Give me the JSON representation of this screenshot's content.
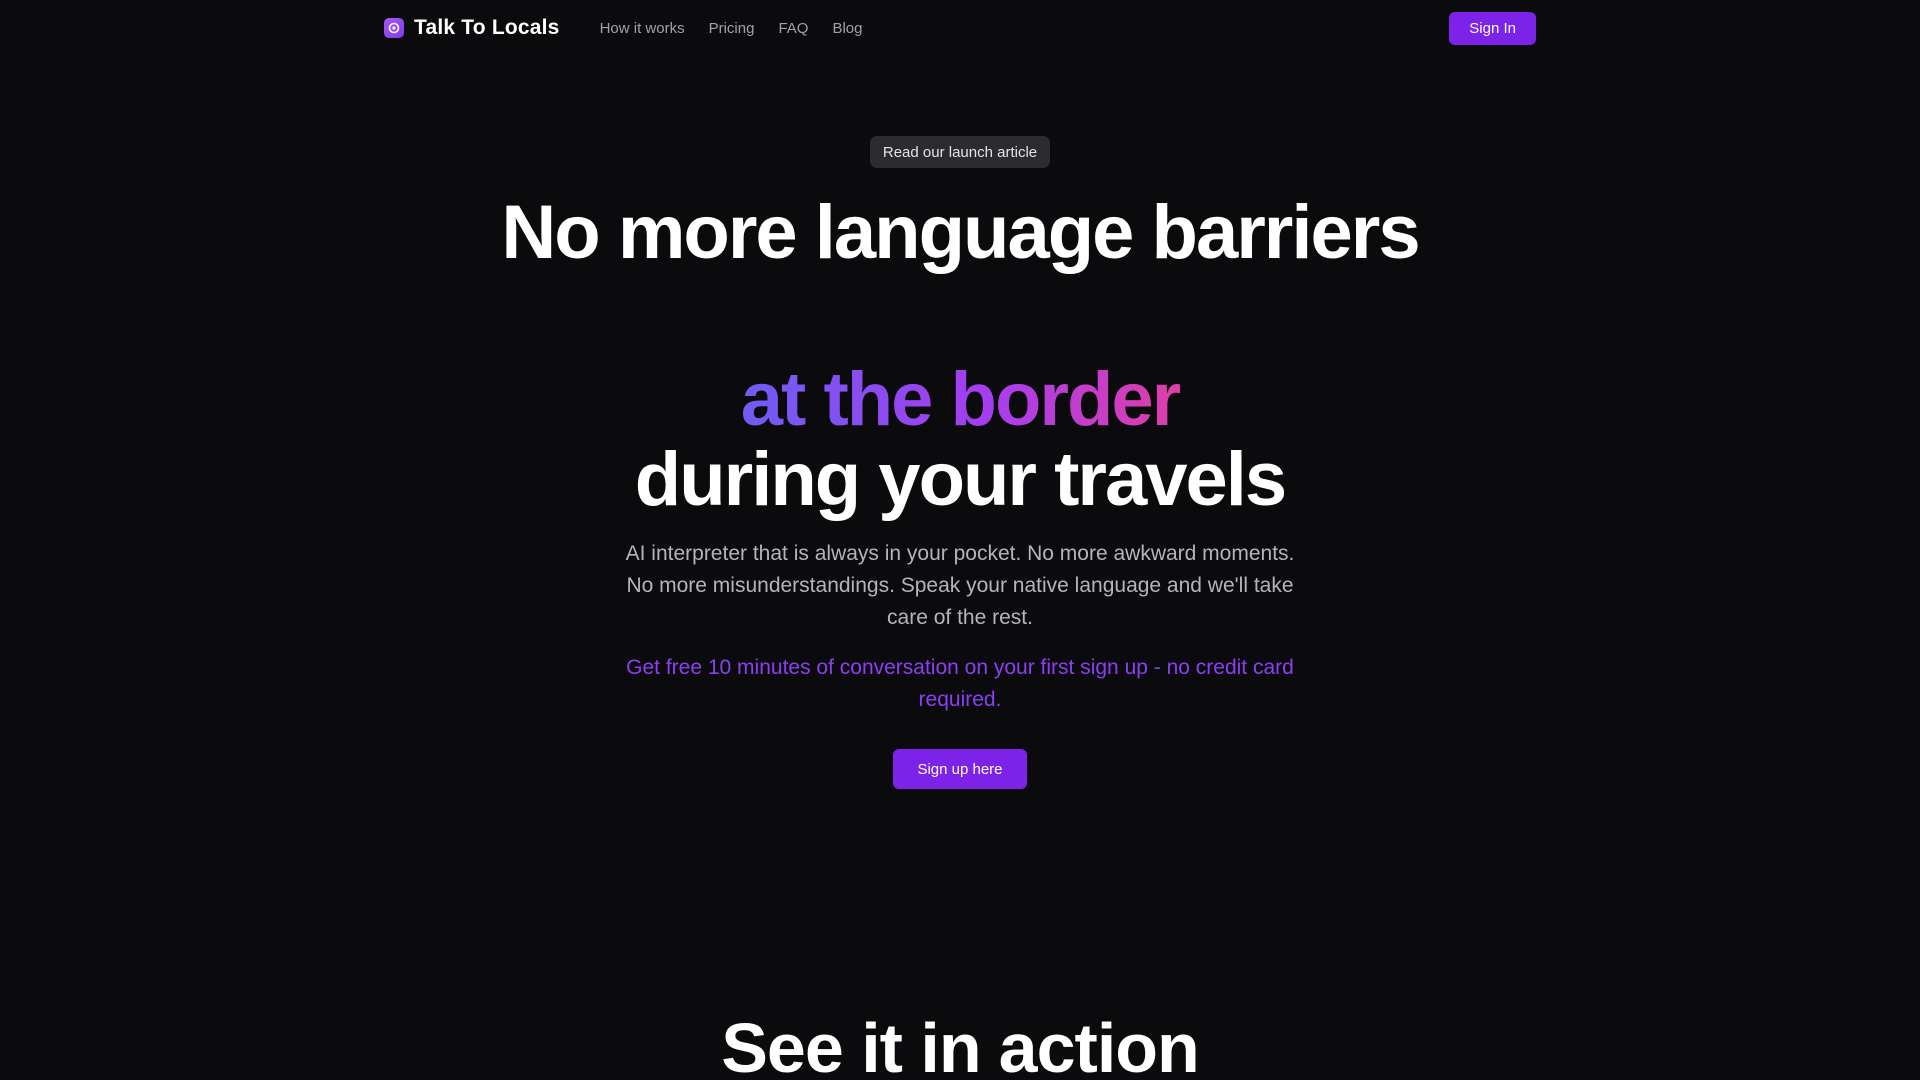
{
  "header": {
    "brand": "Talk To Locals",
    "nav": [
      "How it works",
      "Pricing",
      "FAQ",
      "Blog"
    ],
    "signin_label": "Sign In"
  },
  "hero": {
    "badge": "Read our launch article",
    "headline_line1": "No more language barriers",
    "headline_accent": "at the border",
    "headline_line3": "during your travels",
    "subtitle": "AI interpreter that is always in your pocket. No more awkward moments. No more misunderstandings. Speak your native language and we'll take care of the rest.",
    "promo": "Get free 10 minutes of conversation on your first sign up - no credit card required.",
    "cta_label": "Sign up here"
  },
  "section": {
    "title_prefix": "See it in",
    "title_accent": "action"
  },
  "colors": {
    "background": "#0b0b0d",
    "accent": "#7c22e9",
    "promo_text": "#8b3ef5",
    "gradient": [
      "#6d5df3",
      "#a43ef0",
      "#e13ea6"
    ]
  }
}
